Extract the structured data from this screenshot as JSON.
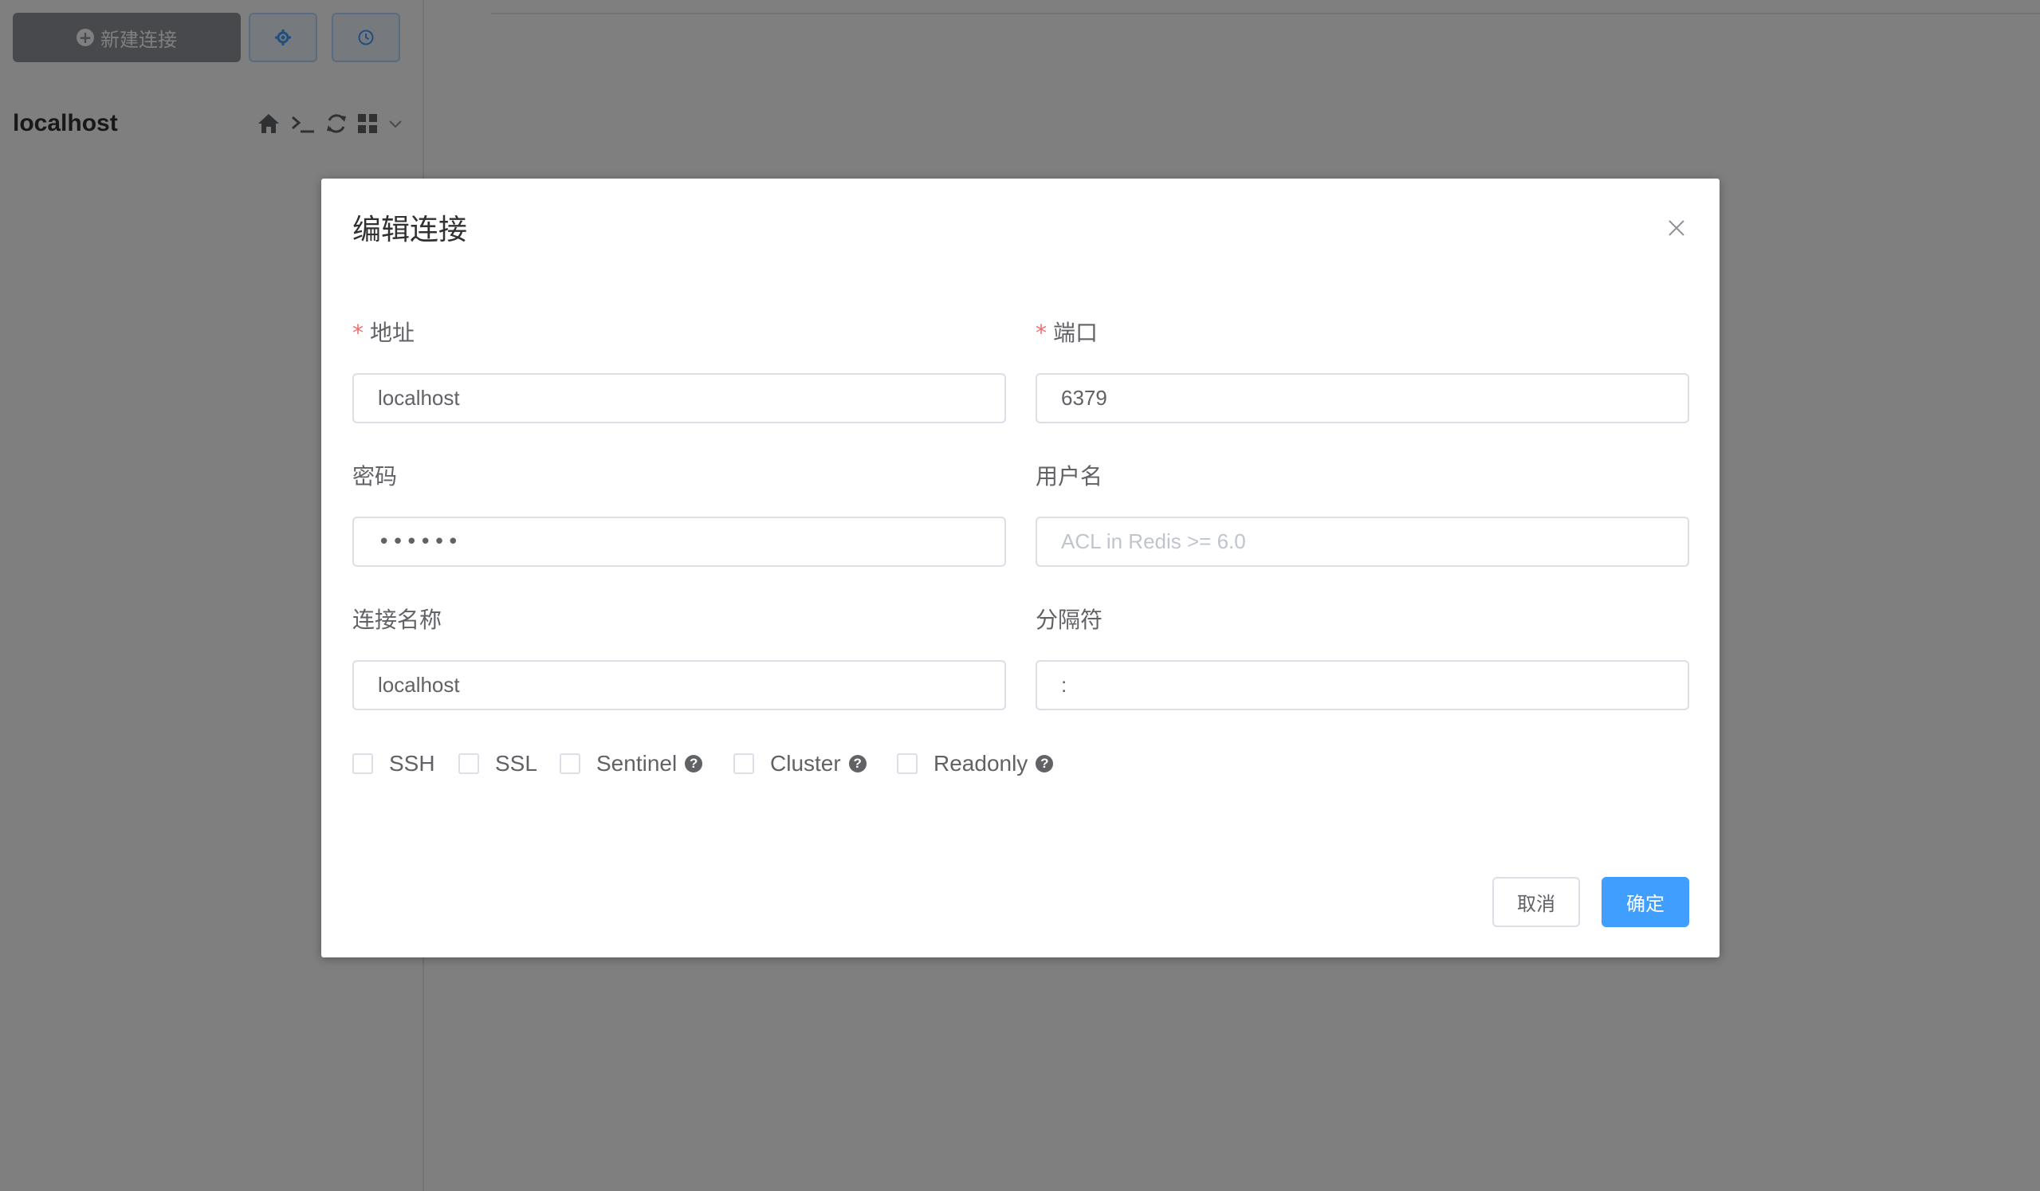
{
  "sidebar": {
    "new_connection_label": "新建连接",
    "connection": {
      "name": "localhost"
    }
  },
  "dialog": {
    "title": "编辑连接",
    "fields": {
      "host": {
        "label": "地址",
        "required": true,
        "value": "localhost"
      },
      "port": {
        "label": "端口",
        "required": true,
        "value": "6379"
      },
      "password": {
        "label": "密码",
        "value": "••••••"
      },
      "username": {
        "label": "用户名",
        "value": "",
        "placeholder": "ACL in Redis >= 6.0"
      },
      "connection_name": {
        "label": "连接名称",
        "value": "localhost"
      },
      "separator": {
        "label": "分隔符",
        "value": ":"
      }
    },
    "options": [
      {
        "label": "SSH",
        "checked": false,
        "help": false
      },
      {
        "label": "SSL",
        "checked": false,
        "help": false
      },
      {
        "label": "Sentinel",
        "checked": false,
        "help": true
      },
      {
        "label": "Cluster",
        "checked": false,
        "help": true
      },
      {
        "label": "Readonly",
        "checked": false,
        "help": true
      }
    ],
    "help_glyph": "?",
    "cancel_label": "取消",
    "confirm_label": "确定"
  },
  "colors": {
    "primary": "#409eff",
    "required_mark": "#f56c6c",
    "overlay": "rgba(0,0,0,0.5)"
  },
  "icons": {
    "new_connection": "plus-circle-icon",
    "settings": "gear-icon",
    "history": "clock-icon",
    "home": "home-icon",
    "terminal": "terminal-icon",
    "refresh": "refresh-icon",
    "grid": "grid-icon",
    "dropdown": "chevron-down-icon",
    "close": "close-icon",
    "help": "question-circle-icon"
  }
}
